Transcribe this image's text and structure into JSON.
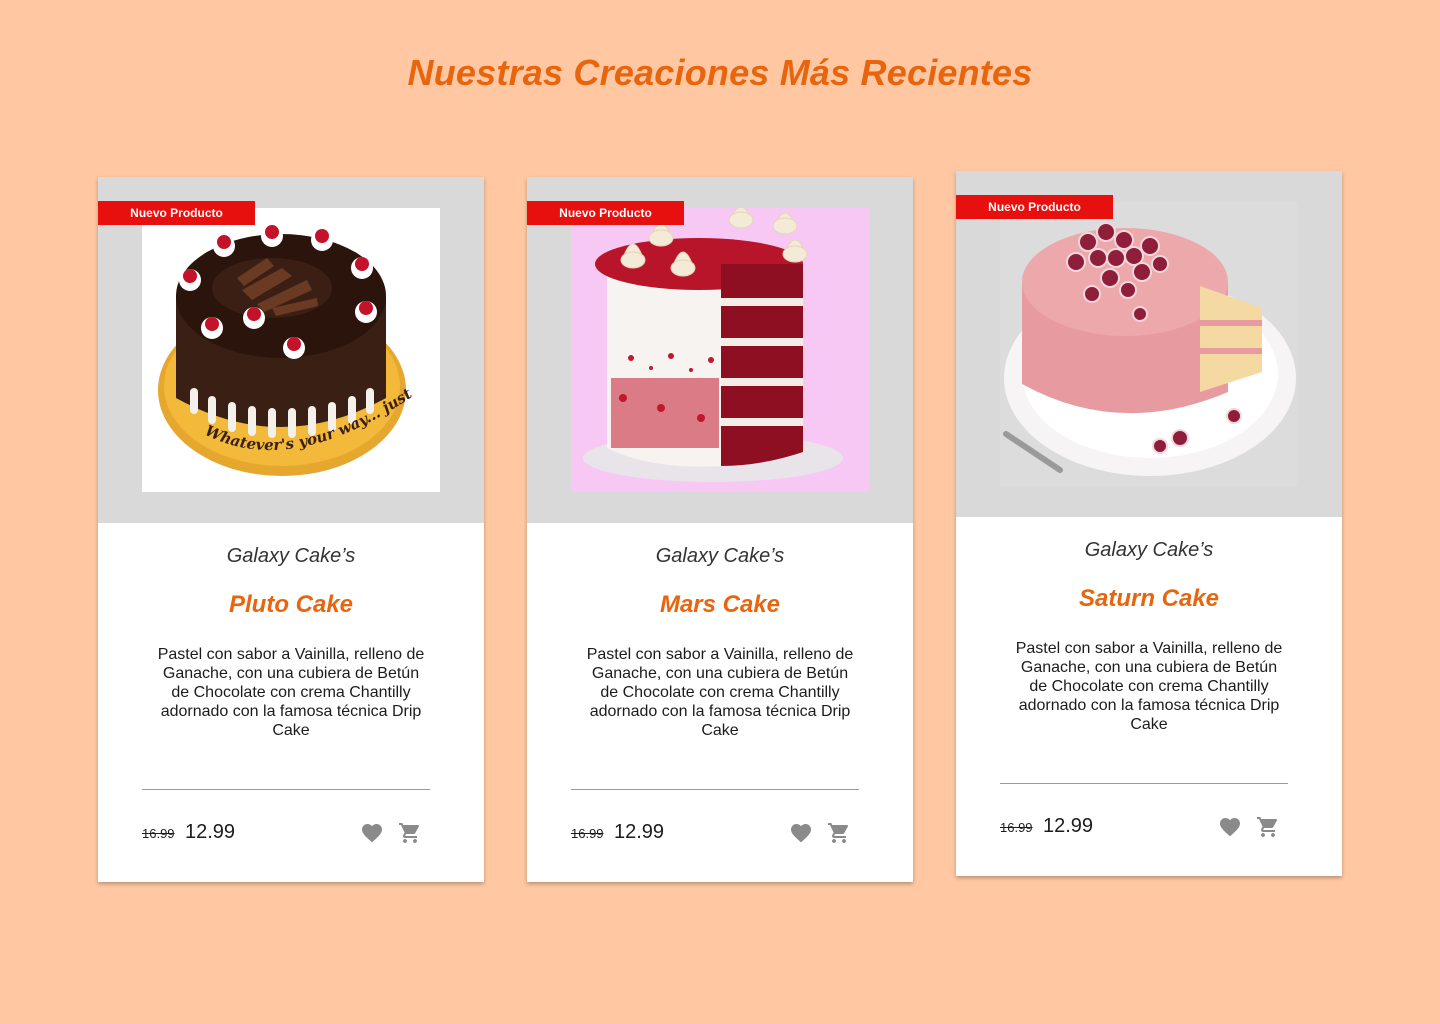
{
  "page": {
    "title": "Nuestras Creaciones Más Recientes"
  },
  "colors": {
    "background": "#FFC8A2",
    "accent": "#E8650E",
    "badge": "#E80F0F",
    "icon": "#8A8A8A"
  },
  "products": [
    {
      "badge": "Nuevo Producto",
      "brand": "Galaxy Cake’s",
      "name": "Pluto Cake",
      "description": "Pastel con sabor a Vainilla, relleno de Ganache, con una cubiera de Betún de Chocolate con crema Chantilly adornado con la famosa técnica Drip Cake",
      "old_price": "16.99",
      "price": "12.99",
      "cake_plate_text": "Whatever's your way... just celebrate!",
      "favorite_icon": "heart-icon",
      "cart_icon": "cart-icon"
    },
    {
      "badge": "Nuevo Producto",
      "brand": "Galaxy Cake’s",
      "name": "Mars Cake",
      "description": "Pastel con sabor a Vainilla, relleno de Ganache, con una cubiera de Betún de Chocolate con crema Chantilly adornado con la famosa técnica Drip Cake",
      "old_price": "16.99",
      "price": "12.99",
      "favorite_icon": "heart-icon",
      "cart_icon": "cart-icon"
    },
    {
      "badge": "Nuevo Producto",
      "brand": "Galaxy Cake’s",
      "name": "Saturn Cake",
      "description": "Pastel con sabor a Vainilla, relleno de Ganache, con una cubiera de Betún de Chocolate con crema Chantilly adornado con la famosa técnica Drip Cake",
      "old_price": "16.99",
      "price": "12.99",
      "favorite_icon": "heart-icon",
      "cart_icon": "cart-icon"
    }
  ]
}
